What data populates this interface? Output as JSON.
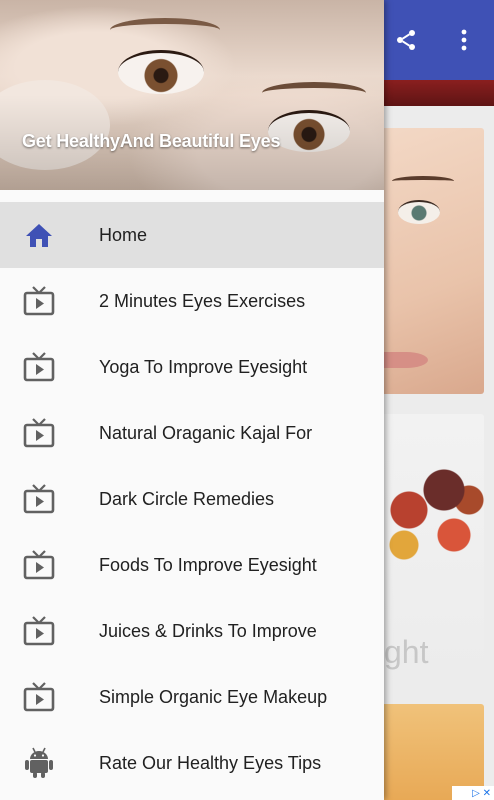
{
  "drawer": {
    "header_title": "Get HealthyAnd Beautiful Eyes",
    "items": [
      {
        "label": "Home",
        "icon": "home-icon",
        "active": true
      },
      {
        "label": "2 Minutes Eyes Exercises",
        "icon": "tv-icon"
      },
      {
        "label": "Yoga To Improve Eyesight",
        "icon": "tv-icon"
      },
      {
        "label": "Natural Oraganic Kajal For",
        "icon": "tv-icon"
      },
      {
        "label": "Dark Circle Remedies",
        "icon": "tv-icon"
      },
      {
        "label": "Foods To Improve Eyesight",
        "icon": "tv-icon"
      },
      {
        "label": "Juices & Drinks To Improve",
        "icon": "tv-icon"
      },
      {
        "label": "Simple Organic Eye Makeup",
        "icon": "tv-icon"
      },
      {
        "label": "Rate Our Healthy Eyes Tips",
        "icon": "android-icon"
      }
    ]
  },
  "background": {
    "card2_text": "ght",
    "ad_badge": "▷ ✕"
  },
  "colors": {
    "appbar": "#3f51b5",
    "active_icon": "#3f51b5",
    "inactive_icon": "#616161",
    "active_item_bg": "#e0e0e0"
  }
}
